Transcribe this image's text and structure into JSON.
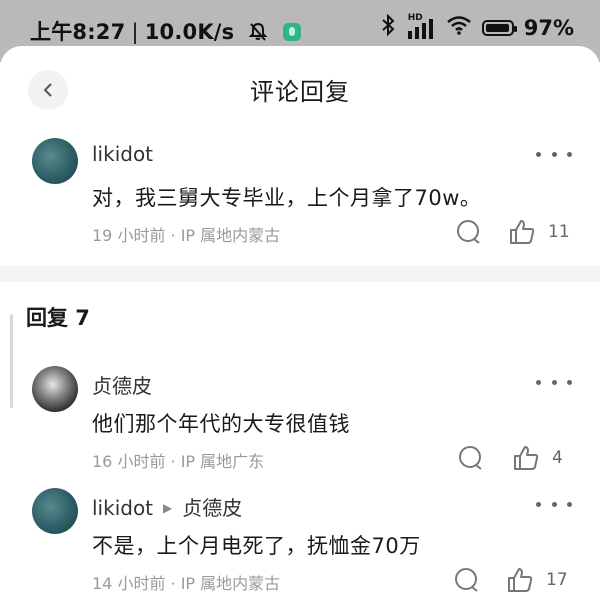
{
  "status_bar": {
    "time": "上午8:27",
    "net_speed": "10.0K/s",
    "signal_label": "HD",
    "battery": "97%",
    "battery_level": 0.97
  },
  "header": {
    "title": "评论回复"
  },
  "main_comment": {
    "username": "likidot",
    "text": "对，我三舅大专毕业，上个月拿了70w。",
    "meta": "19 小时前 · IP 属地内蒙古",
    "likes": "11"
  },
  "replies_section": {
    "title": "回复 7"
  },
  "replies": [
    {
      "username": "贞德皮",
      "reply_to": "",
      "text": "他们那个年代的大专很值钱",
      "meta": "16 小时前 · IP 属地广东",
      "likes": "4"
    },
    {
      "username": "likidot",
      "reply_to": "贞德皮",
      "text": "不是，上个月电死了，抚恤金70万",
      "meta": "14 小时前 · IP 属地内蒙古",
      "likes": "17"
    }
  ],
  "colors": {
    "status_bg": "#b9b9b9",
    "divider": "#f3f3f3",
    "meta_text": "#9a9a9a"
  },
  "icons": [
    "back-icon",
    "more-icon",
    "comment-icon",
    "like-icon",
    "bluetooth-icon",
    "wifi-icon",
    "signal-icon",
    "battery-icon",
    "mute-bell-icon"
  ]
}
